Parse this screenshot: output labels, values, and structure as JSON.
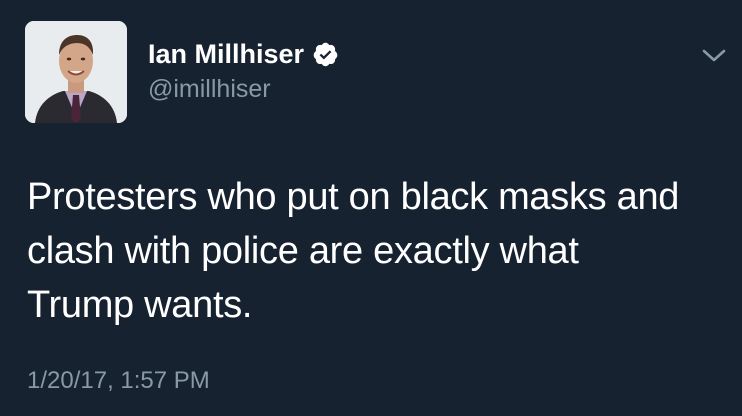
{
  "tweet": {
    "display_name": "Ian Millhiser",
    "handle": "@imillhiser",
    "text": "Protesters who put on black masks and\nclash with police are exactly what\nTrump wants.",
    "timestamp": "1/20/17, 1:57 PM",
    "verified": true
  },
  "icons": {
    "avatar": "profile-photo",
    "verified": "verified-badge-icon",
    "menu": "chevron-down-icon"
  },
  "colors": {
    "background": "#172231",
    "primary_text": "#ffffff",
    "secondary_text": "#8899a6",
    "verified_badge": "#ffffff"
  }
}
